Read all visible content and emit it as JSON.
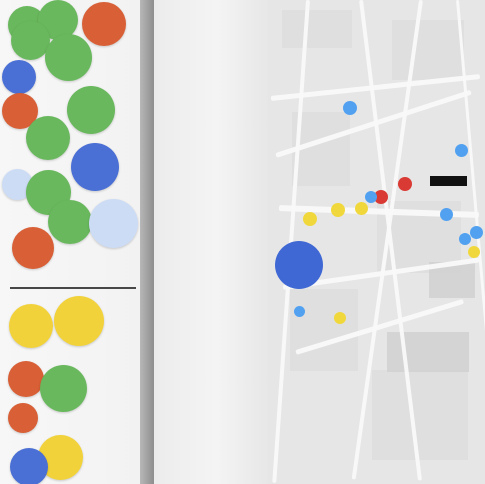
{
  "scene": {
    "board": "board",
    "map": "map"
  }
}
